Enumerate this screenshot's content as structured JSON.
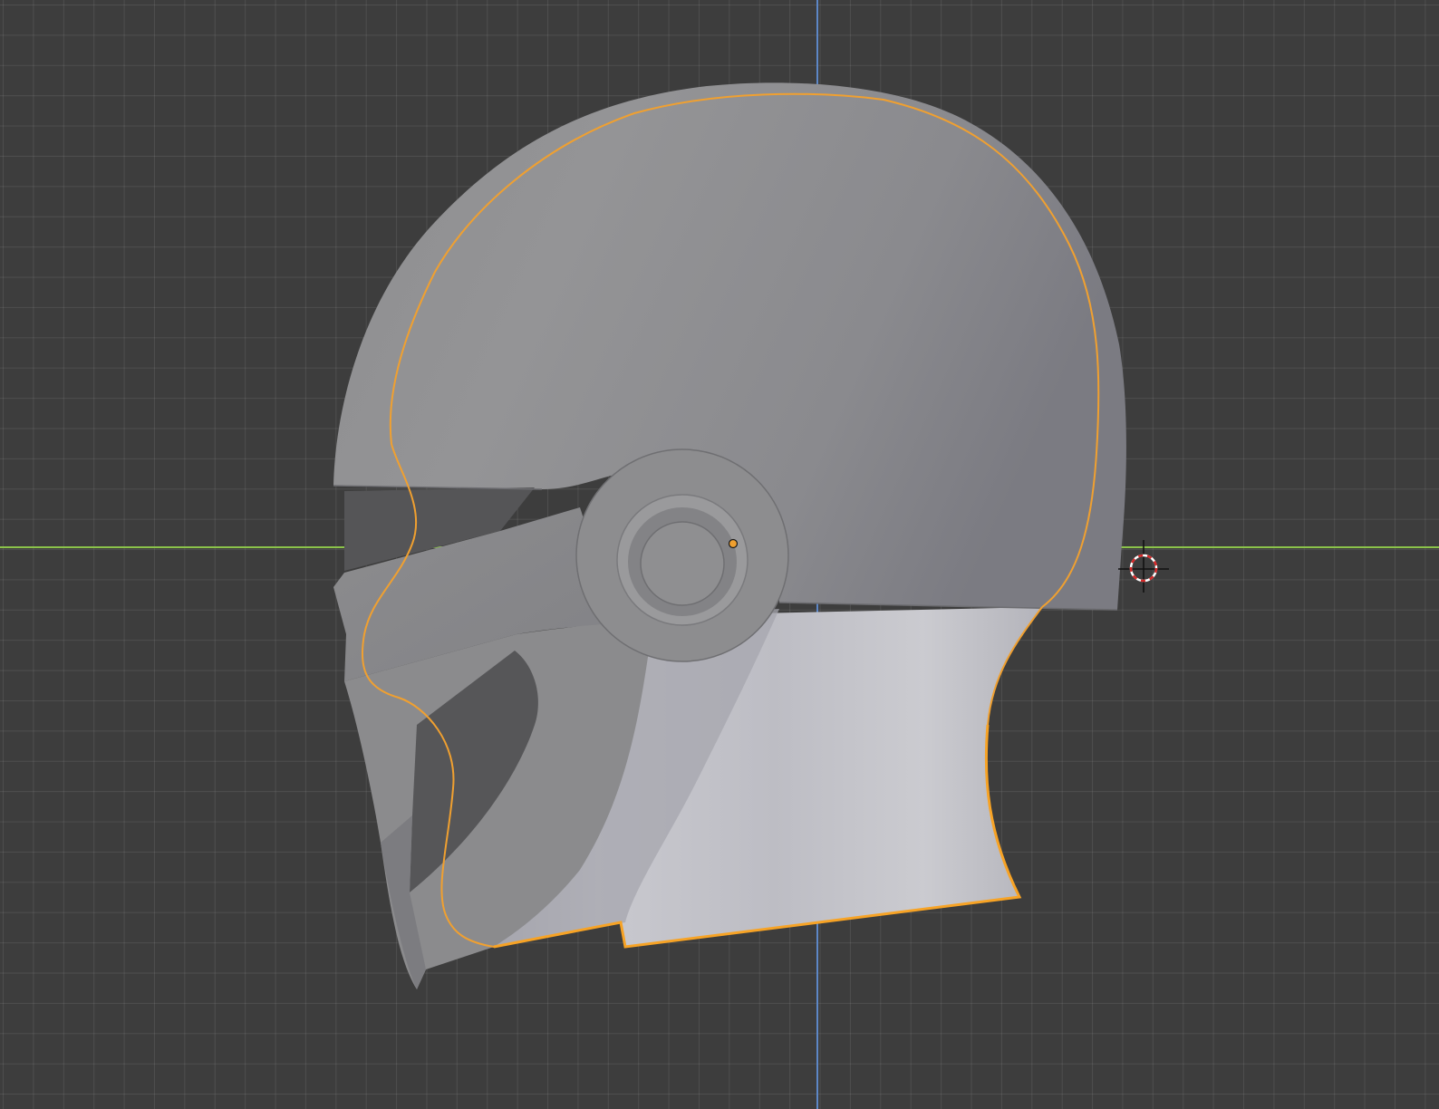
{
  "app": {
    "name": "",
    "view": "3d-viewport"
  },
  "viewport": {
    "background": "#3d3d3d",
    "grid_color": "#4a4a4a",
    "axis_x_color": "#8bc34a",
    "axis_z_color": "#5d87c7",
    "object_body": "#8f8f91",
    "object_neck": "#c8c8cc",
    "selection_outline": "#f0a030",
    "origin_color": "#f0a030",
    "cursor_ring": "#d62828"
  },
  "scene": {
    "object": "helmet-mesh",
    "selected": true,
    "icons": [
      "3d-cursor-icon",
      "object-origin-icon"
    ]
  }
}
